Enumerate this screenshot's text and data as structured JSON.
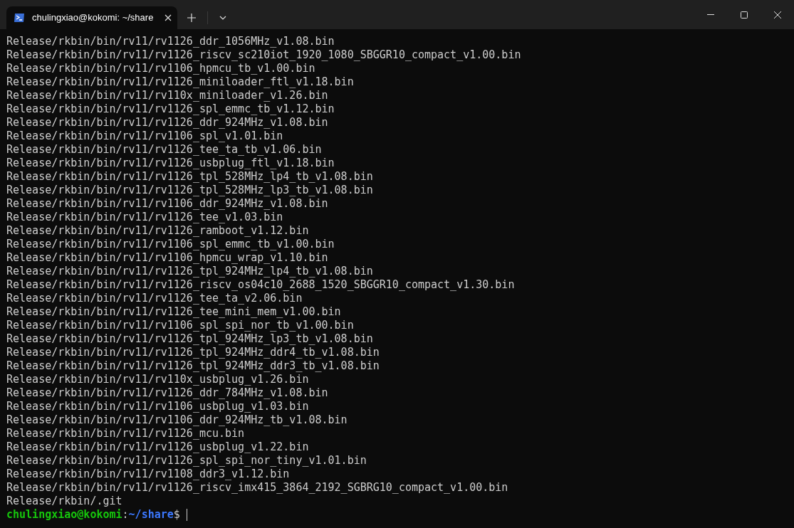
{
  "tab": {
    "title": "chulingxiao@kokomi: ~/share",
    "selected": true
  },
  "lines": [
    "Release/rkbin/bin/rv11/rv1126_ddr_1056MHz_v1.08.bin",
    "Release/rkbin/bin/rv11/rv1126_riscv_sc210iot_1920_1080_SBGGR10_compact_v1.00.bin",
    "Release/rkbin/bin/rv11/rv1106_hpmcu_tb_v1.00.bin",
    "Release/rkbin/bin/rv11/rv1126_miniloader_ftl_v1.18.bin",
    "Release/rkbin/bin/rv11/rv110x_miniloader_v1.26.bin",
    "Release/rkbin/bin/rv11/rv1126_spl_emmc_tb_v1.12.bin",
    "Release/rkbin/bin/rv11/rv1126_ddr_924MHz_v1.08.bin",
    "Release/rkbin/bin/rv11/rv1106_spl_v1.01.bin",
    "Release/rkbin/bin/rv11/rv1126_tee_ta_tb_v1.06.bin",
    "Release/rkbin/bin/rv11/rv1126_usbplug_ftl_v1.18.bin",
    "Release/rkbin/bin/rv11/rv1126_tpl_528MHz_lp4_tb_v1.08.bin",
    "Release/rkbin/bin/rv11/rv1126_tpl_528MHz_lp3_tb_v1.08.bin",
    "Release/rkbin/bin/rv11/rv1106_ddr_924MHz_v1.08.bin",
    "Release/rkbin/bin/rv11/rv1126_tee_v1.03.bin",
    "Release/rkbin/bin/rv11/rv1126_ramboot_v1.12.bin",
    "Release/rkbin/bin/rv11/rv1106_spl_emmc_tb_v1.00.bin",
    "Release/rkbin/bin/rv11/rv1106_hpmcu_wrap_v1.10.bin",
    "Release/rkbin/bin/rv11/rv1126_tpl_924MHz_lp4_tb_v1.08.bin",
    "Release/rkbin/bin/rv11/rv1126_riscv_os04c10_2688_1520_SBGGR10_compact_v1.30.bin",
    "Release/rkbin/bin/rv11/rv1126_tee_ta_v2.06.bin",
    "Release/rkbin/bin/rv11/rv1126_tee_mini_mem_v1.00.bin",
    "Release/rkbin/bin/rv11/rv1106_spl_spi_nor_tb_v1.00.bin",
    "Release/rkbin/bin/rv11/rv1126_tpl_924MHz_lp3_tb_v1.08.bin",
    "Release/rkbin/bin/rv11/rv1126_tpl_924MHz_ddr4_tb_v1.08.bin",
    "Release/rkbin/bin/rv11/rv1126_tpl_924MHz_ddr3_tb_v1.08.bin",
    "Release/rkbin/bin/rv11/rv110x_usbplug_v1.26.bin",
    "Release/rkbin/bin/rv11/rv1126_ddr_784MHz_v1.08.bin",
    "Release/rkbin/bin/rv11/rv1106_usbplug_v1.03.bin",
    "Release/rkbin/bin/rv11/rv1106_ddr_924MHz_tb_v1.08.bin",
    "Release/rkbin/bin/rv11/rv1126_mcu.bin",
    "Release/rkbin/bin/rv11/rv1126_usbplug_v1.22.bin",
    "Release/rkbin/bin/rv11/rv1126_spl_spi_nor_tiny_v1.01.bin",
    "Release/rkbin/bin/rv11/rv1108_ddr3_v1.12.bin",
    "Release/rkbin/bin/rv11/rv1126_riscv_imx415_3864_2192_SGBRG10_compact_v1.00.bin",
    "Release/rkbin/.git"
  ],
  "prompt": {
    "user_host": "chulingxiao@kokomi",
    "separator": ":",
    "path": "~/share",
    "symbol": "$"
  }
}
